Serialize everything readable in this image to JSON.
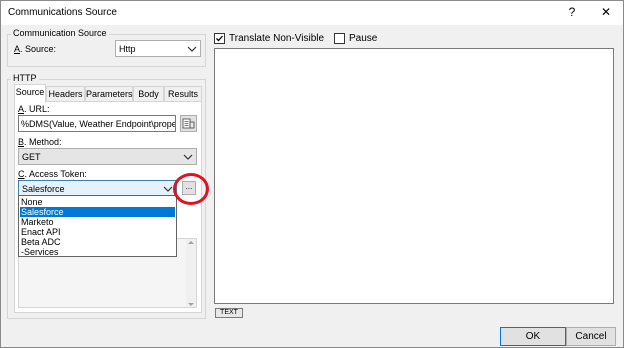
{
  "window": {
    "title": "Communications Source",
    "help_glyph": "?",
    "close_glyph": "✕"
  },
  "comm_source": {
    "group_title": "Communication Source",
    "source_label_key": "A",
    "source_label_rest": ". Source:",
    "source_value": "Http"
  },
  "http": {
    "group_title": "HTTP",
    "tabs": [
      {
        "label": "Source",
        "selected": true
      },
      {
        "label": "Headers",
        "selected": false
      },
      {
        "label": "Parameters",
        "selected": false
      },
      {
        "label": "Body",
        "selected": false
      },
      {
        "label": "Results",
        "selected": false
      }
    ],
    "url_label_key": "A",
    "url_label_rest": ". URL:",
    "url_value": "%DMS(Value, Weather Endpoint\\properties",
    "method_label_key": "B",
    "method_label_rest": ". Method:",
    "method_value": "GET",
    "token_label_key": "C",
    "token_label_rest": ". Access Token:",
    "token_value": "Salesforce",
    "browse_label": "...",
    "token_options": [
      {
        "label": "None",
        "selected": false
      },
      {
        "label": "Salesforce",
        "selected": true
      },
      {
        "label": "Marketo",
        "selected": false
      },
      {
        "label": "Enact API",
        "selected": false
      },
      {
        "label": "Beta ADC",
        "selected": false
      },
      {
        "label": "-Services",
        "selected": false
      }
    ]
  },
  "options": {
    "translate_label": "Translate Non-Visible",
    "translate_checked": true,
    "pause_label": "Pause",
    "pause_checked": false
  },
  "preview": {
    "text_button_label": "TEXT"
  },
  "footer": {
    "ok_label": "OK",
    "cancel_label": "Cancel"
  },
  "icons": {
    "chevron": "chevron-down-icon",
    "insert": "insert-field-icon"
  },
  "colors": {
    "selection": "#0078d7",
    "highlight_circle": "#e0141e",
    "dialog_bg": "#f0f0f0"
  }
}
